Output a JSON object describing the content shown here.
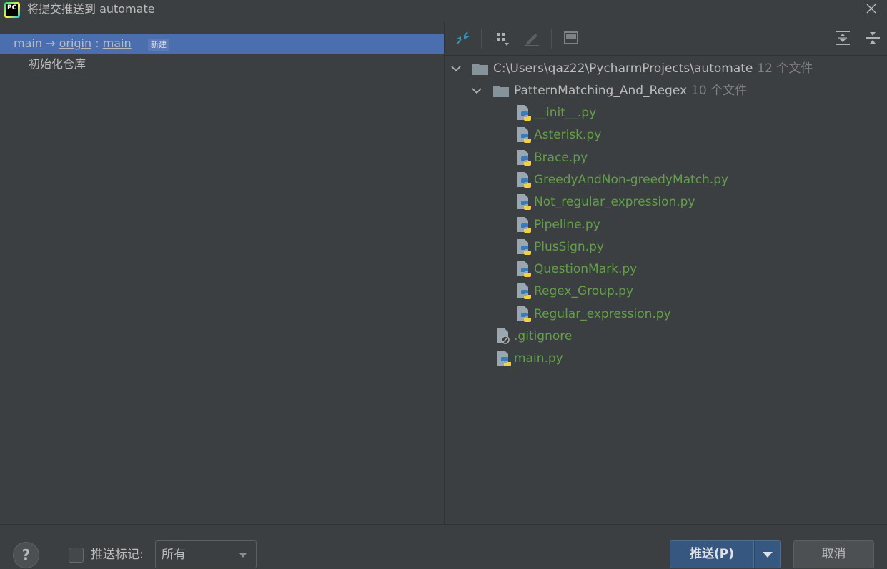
{
  "window": {
    "title": "将提交推送到 automate",
    "app_icon": "pycharm-icon",
    "app_icon_text": "PC"
  },
  "left_pane": {
    "branch": {
      "local": "main",
      "arrow": "→",
      "remote": "origin",
      "separator": ":",
      "remote_branch": "main",
      "badge": "新建"
    },
    "commits": [
      {
        "message": "初始化仓库"
      }
    ]
  },
  "toolbar": {
    "icons": [
      "diff-arrows-icon",
      "group-by-icon",
      "edit-source-icon",
      "preview-icon",
      "expand-all-icon",
      "collapse-all-icon"
    ]
  },
  "tree": {
    "root": {
      "path": "C:\\Users\\qaz22\\PycharmProjects\\automate",
      "count": "12 个文件"
    },
    "folder": {
      "name": "PatternMatching_And_Regex",
      "count": "10 个文件"
    },
    "folder_files": [
      "__init__.py",
      "Asterisk.py",
      "Brace.py",
      "GreedyAndNon-greedyMatch.py",
      "Not_regular_expression.py",
      "Pipeline.py",
      "PlusSign.py",
      "QuestionMark.py",
      "Regex_Group.py",
      "Regular_expression.py"
    ],
    "root_files": [
      {
        "name": ".gitignore",
        "icon": "ignored-file-icon"
      },
      {
        "name": "main.py",
        "icon": "python-file-icon"
      }
    ]
  },
  "footer": {
    "help": "?",
    "push_tags_label": "推送标记:",
    "push_tags_checked": false,
    "tags_select_value": "所有",
    "push_button": "推送(P)",
    "cancel_button": "取消"
  },
  "colors": {
    "background": "#3c3f41",
    "selection": "#4b6eaf",
    "added_file": "#62a048",
    "primary_button": "#365880"
  }
}
